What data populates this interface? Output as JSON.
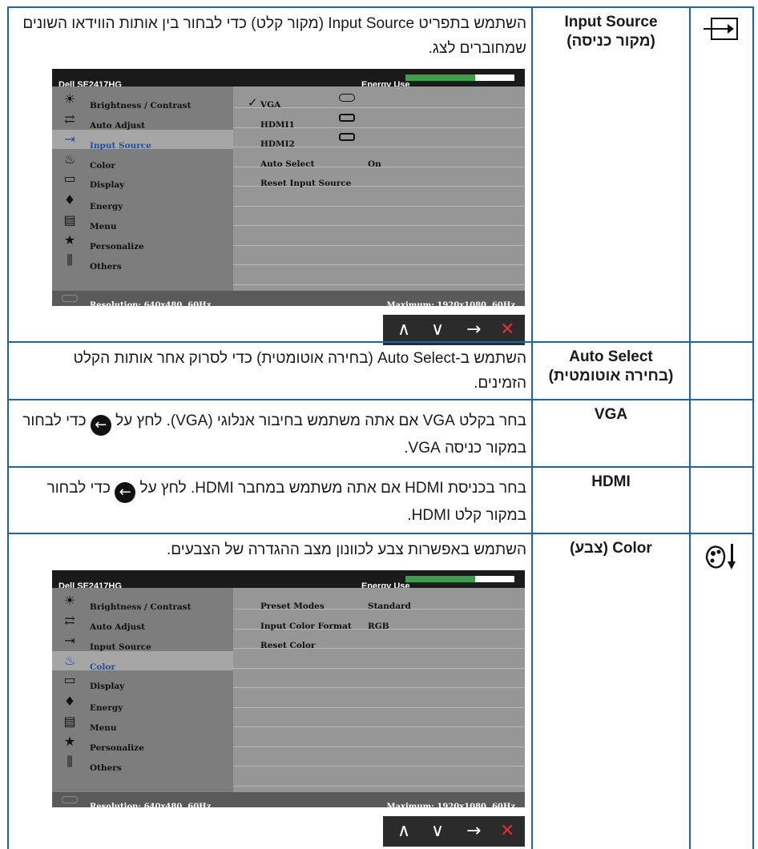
{
  "input_source": {
    "name": "Input Source\n(מקור כניסה)",
    "name_l1": "Input Source",
    "name_l2": "(מקור כניסה)",
    "desc": "השתמש בתפריט Input Source (מקור קלט) כדי לבחור בין אותות הווידאו השונים שמחוברים לצג.",
    "icon": "input-source-icon"
  },
  "auto_select": {
    "name_l1": "Auto Select",
    "name_l2": "(בחירה אוטומטית)",
    "desc": "השתמש ב-Auto Select (בחירה אוטומטית) כדי לסרוק אחר אותות הקלט הזמינים."
  },
  "vga": {
    "name": "VGA",
    "desc_a": "בחר בקלט VGA אם אתה משתמש בחיבור אנלוגי (VGA). לחץ על",
    "desc_b": "כדי לבחור במקור כניסה VGA."
  },
  "hdmi": {
    "name": "HDMI",
    "desc_a": "בחר בכניסת HDMI אם אתה משתמש במחבר HDMI. לחץ על",
    "desc_b": "כדי לבחור במקור קלט HDMI."
  },
  "color": {
    "name": "Color (צבע)",
    "desc": "השתמש באפשרות צבע לכוונון מצב ההגדרה של הצבעים.",
    "icon": "color-icon"
  },
  "osd": {
    "model": "Dell SE2417HG",
    "energy_use": "Energy Use",
    "energy_level": 0.64,
    "menu": [
      {
        "label": "Brightness / Contrast",
        "icon": "brightness-icon"
      },
      {
        "label": "Auto Adjust",
        "icon": "auto-adjust-icon"
      },
      {
        "label": "Input Source",
        "icon": "input-source-icon"
      },
      {
        "label": "Color",
        "icon": "color-icon"
      },
      {
        "label": "Display",
        "icon": "display-icon"
      },
      {
        "label": "Energy",
        "icon": "energy-icon"
      },
      {
        "label": "Menu",
        "icon": "menu-icon"
      },
      {
        "label": "Personalize",
        "icon": "star-icon"
      },
      {
        "label": "Others",
        "icon": "others-icon"
      }
    ],
    "resolution": "Resolution: 640x480, 60Hz",
    "maximum": "Maximum: 1920x1080, 60Hz",
    "input_rows": [
      {
        "label": "VGA",
        "value": ""
      },
      {
        "label": "HDMI1",
        "value": ""
      },
      {
        "label": "HDMI2",
        "value": ""
      },
      {
        "label": "Auto Select",
        "value": "On"
      },
      {
        "label": "Reset Input Source",
        "value": ""
      }
    ],
    "color_rows": [
      {
        "label": "Preset Modes",
        "value": "Standard"
      },
      {
        "label": "Input Color Format",
        "value": "RGB"
      },
      {
        "label": "Reset Color",
        "value": ""
      }
    ]
  },
  "nav": {
    "up": "∧",
    "down": "∨",
    "right": "→",
    "close": "✕"
  }
}
